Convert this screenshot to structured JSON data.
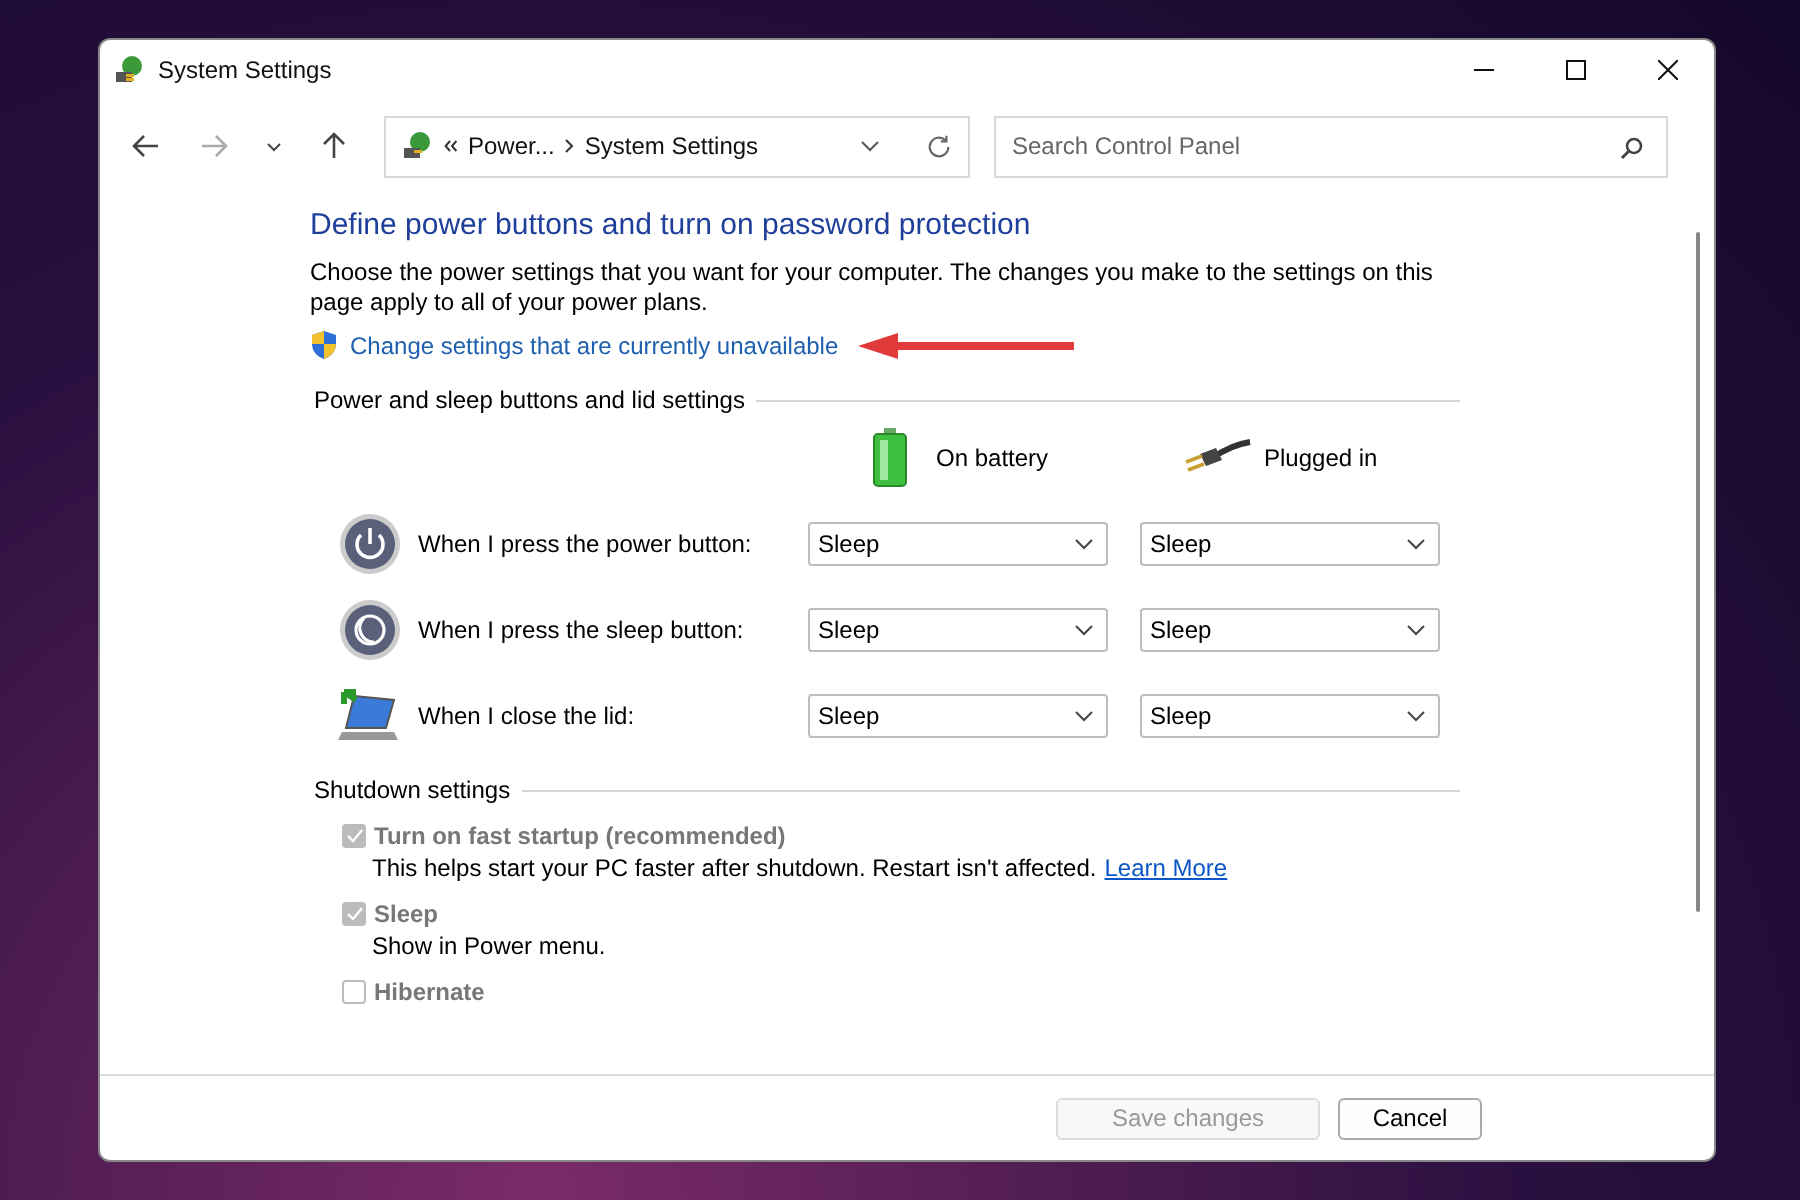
{
  "window": {
    "title": "System Settings"
  },
  "address_bar": {
    "crumbs": [
      "Power...",
      "System Settings"
    ]
  },
  "search": {
    "placeholder": "Search Control Panel"
  },
  "heading": "Define power buttons and turn on password protection",
  "description": "Choose the power settings that you want for your computer. The changes you make to the settings on this page apply to all of your power plans.",
  "admin_link": "Change settings that are currently unavailable",
  "buttons_section": {
    "title": "Power and sleep buttons and lid settings",
    "columns": [
      "On battery",
      "Plugged in"
    ],
    "rows": [
      {
        "kind": "power",
        "label": "When I press the power button:",
        "values": [
          "Sleep",
          "Sleep"
        ]
      },
      {
        "kind": "sleep",
        "label": "When I press the sleep button:",
        "values": [
          "Sleep",
          "Sleep"
        ]
      },
      {
        "kind": "lid",
        "label": "When I close the lid:",
        "values": [
          "Sleep",
          "Sleep"
        ]
      }
    ]
  },
  "shutdown_section": {
    "title": "Shutdown settings",
    "options": [
      {
        "label": "Turn on fast startup (recommended)",
        "checked": true,
        "disabled": true,
        "description": "This helps start your PC faster after shutdown. Restart isn't affected.",
        "link": "Learn More"
      },
      {
        "label": "Sleep",
        "checked": true,
        "disabled": true,
        "description": "Show in Power menu."
      },
      {
        "label": "Hibernate",
        "checked": false,
        "disabled": true
      }
    ]
  },
  "footer_buttons": [
    {
      "label": "Save changes",
      "disabled": true
    },
    {
      "label": "Cancel",
      "disabled": false
    }
  ]
}
